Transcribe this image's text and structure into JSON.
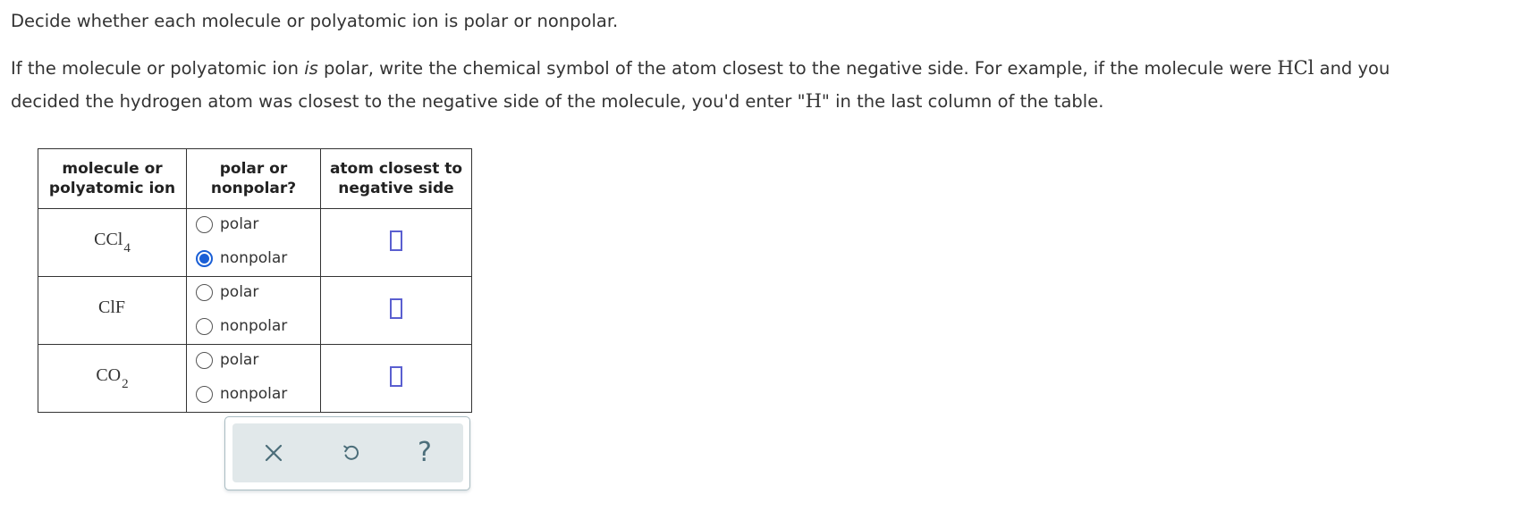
{
  "instructions": {
    "line1": "Decide whether each molecule or polyatomic ion is polar or nonpolar.",
    "line2_a": "If the molecule or polyatomic ion ",
    "line2_is": "is",
    "line2_b": " polar, write the chemical symbol of the atom closest to the negative side. For example, if the molecule were ",
    "example_molecule": "HCl",
    "line2_c": " and you",
    "line3_a": "decided the hydrogen atom was closest to the negative side of the molecule, you'd enter \"",
    "example_symbol": "H",
    "line3_b": "\" in the last column of the table."
  },
  "table": {
    "headers": {
      "col1_line1": "molecule or",
      "col1_line2": "polyatomic ion",
      "col2_line1": "polar or",
      "col2_line2": "nonpolar?",
      "col3_line1": "atom closest to",
      "col3_line2": "negative side"
    },
    "rows": [
      {
        "formula_main": "CCl",
        "formula_sub": "4",
        "polar_label": "polar",
        "nonpolar_label": "nonpolar",
        "selected": "nonpolar",
        "answer": ""
      },
      {
        "formula_main": "ClF",
        "formula_sub": "",
        "polar_label": "polar",
        "nonpolar_label": "nonpolar",
        "selected": "",
        "answer": ""
      },
      {
        "formula_main": "CO",
        "formula_sub": "2",
        "polar_label": "polar",
        "nonpolar_label": "nonpolar",
        "selected": "",
        "answer": ""
      }
    ]
  },
  "toolbar": {
    "clear_icon": "x-icon",
    "undo_icon": "undo-icon",
    "help_label": "?",
    "icon_color": "#4c6e7a"
  },
  "colors": {
    "radio_selected": "#1a5fd6",
    "answer_box_border": "#5a5fd0",
    "toolbar_bg": "#e1e8ea"
  }
}
